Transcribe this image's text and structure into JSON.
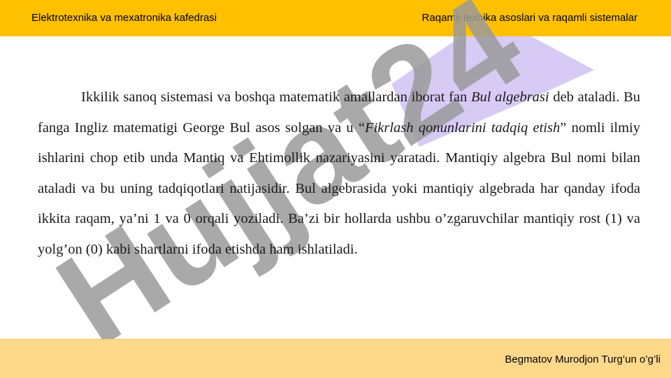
{
  "header": {
    "left_title": "Elektrotexnika va mexatronika kafedrasi",
    "right_title": "Raqamli texnika asoslari va raqamli sistemalar"
  },
  "content": {
    "seg1": "Ikkilik sanoq sistemasi va boshqa matematik amallardan iborat fan ",
    "seg2_italic": "Bul algebrasi",
    "seg3": " deb ataladi. Bu fanga Ingliz matematigi George Bul asos solgan va u “",
    "seg4_italic": "Fikrlash qonunlarini tadqiq etish",
    "seg5": "” nomli ilmiy ishlarini chop etib unda Mantiq va Ehtimollik nazariyasini yaratadi. Mantiqiy algebra Bul nomi bilan ataladi va bu uning tadqiqotlari natijasidir. Bul algebrasida yoki mantiqiy algebrada har qanday ifoda ikkita raqam, ya’ni 1 va 0 orqali yoziladi. Ba’zi bir hollarda ushbu o’zgaruvchilar mantiqiy rost (1) va yolg’on (0) kabi shartlarni ifoda etishda ham ishlatiladi."
  },
  "watermark": {
    "text": "Hujjat24",
    "colors": {
      "letters": "#9b9b9b",
      "accent": "#c9b8f2"
    }
  },
  "footer": {
    "author": "Begmatov Murodjon Turg’un o’g’li"
  },
  "colors": {
    "header_bg": "#ffc000",
    "footer_bg": "#ffd98a"
  }
}
